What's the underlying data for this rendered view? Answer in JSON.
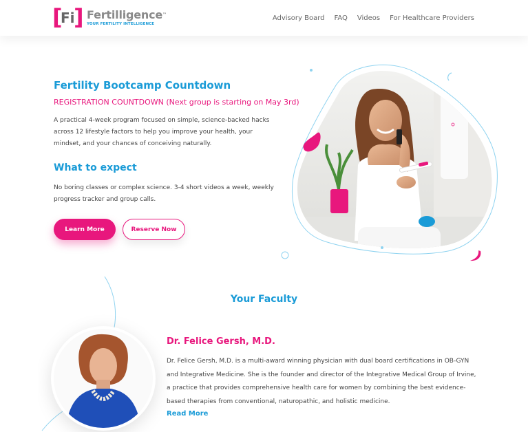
{
  "header": {
    "logo": {
      "mark": "Fi",
      "name": "Fertilligence",
      "trademark": "™",
      "tagline": "YOUR FERTILITY INTELLIGENCE"
    },
    "nav": [
      "Advisory Board",
      "FAQ",
      "Videos",
      "For Healthcare Providers"
    ]
  },
  "hero": {
    "title": "Fertility Bootcamp Countdown",
    "countdown": "REGISTRATION COUNTDOWN (Next group is starting on May 3rd)",
    "description": "A practical 4-week program focused on simple, science-backed hacks across 12 lifestyle factors to help you improve your health, your mindset, and your chances of conceiving naturally.",
    "expect_title": "What to expect",
    "expect_description": "No boring classes or complex science. 3-4 short videos a week, weekly progress tracker and group calls.",
    "learn_more_label": "Learn More",
    "reserve_label": "Reserve Now"
  },
  "faculty": {
    "title": "Your Faculty",
    "members": [
      {
        "name": "Dr. Felice Gersh, M.D.",
        "bio": "Dr. Felice Gersh, M.D. is a multi-award winning physician with dual board certifications in OB-GYN and Integrative Medicine. She is the founder and director of the Integrative Medical Group of Irvine, a practice that provides comprehensive health care for women by combining the best evidence-based therapies from conventional, naturopathic, and holistic medicine.",
        "read_more": "Read More"
      }
    ]
  },
  "colors": {
    "brand_pink": "#e8177d",
    "brand_blue": "#1a9bd7",
    "text_gray": "#444444"
  }
}
